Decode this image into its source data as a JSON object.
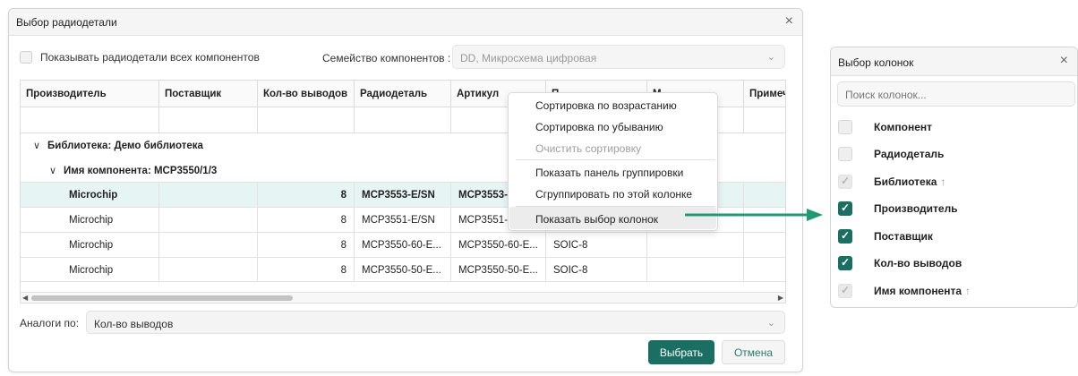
{
  "dialog": {
    "title": "Выбор радиодетали",
    "close": "×",
    "show_all_label": "Показывать радиодетали всех компонентов",
    "family_label": "Семейство компонентов :",
    "family_value": "DD, Микросхема цифровая",
    "chev": "⌄",
    "analog_label": "Аналоги по:",
    "analog_value": "Кол-во выводов",
    "select_btn": "Выбрать",
    "cancel_btn": "Отмена"
  },
  "grid": {
    "headers": [
      "Производитель",
      "Поставщик",
      "Кол-во выводов",
      "Радиодеталь",
      "Артикул",
      "П",
      "М",
      "Примеч"
    ],
    "group1": "Библиотека: Демо библиотека",
    "group2": "Имя компонента: MCP3550/1/3",
    "caret": "∨",
    "rows": [
      {
        "maker": "Microchip",
        "supplier": "",
        "pins": "8",
        "part": "MCP3553-E/SN",
        "article": "MCP3553-",
        "pkg": ""
      },
      {
        "maker": "Microchip",
        "supplier": "",
        "pins": "8",
        "part": "MCP3551-E/SN",
        "article": "MCP3551-E",
        "pkg": ""
      },
      {
        "maker": "Microchip",
        "supplier": "",
        "pins": "8",
        "part": "MCP3550-60-E...",
        "article": "MCP3550-60-E...",
        "pkg": "SOIC-8"
      },
      {
        "maker": "Microchip",
        "supplier": "",
        "pins": "8",
        "part": "MCP3550-50-E...",
        "article": "MCP3550-50-E...",
        "pkg": "SOIC-8"
      }
    ],
    "scroll_left": "◀",
    "scroll_right": "▶"
  },
  "context_menu": {
    "sort_asc": "Сортировка по возрастанию",
    "sort_desc": "Сортировка по убыванию",
    "clear_sort": "Очистить сортировку",
    "show_group_panel": "Показать панель группировки",
    "group_by_column": "Сгруппировать по этой колонке",
    "show_column_chooser": "Показать выбор колонок"
  },
  "column_panel": {
    "title": "Выбор колонок",
    "close": "×",
    "search_placeholder": "Поиск колонок...",
    "up_arrow": "↑",
    "items": [
      {
        "label": "Компонент",
        "state": "off"
      },
      {
        "label": "Радиодеталь",
        "state": "off"
      },
      {
        "label": "Библиотека",
        "state": "dis"
      },
      {
        "label": "Производитель",
        "state": "on"
      },
      {
        "label": "Поставщик",
        "state": "on"
      },
      {
        "label": "Кол-во выводов",
        "state": "on"
      },
      {
        "label": "Имя компонента",
        "state": "dis"
      }
    ],
    "check": "✓"
  },
  "colors": {
    "accent": "#1a6e62",
    "arrow": "#1f9a74",
    "selected_row": "#e6f4f3"
  }
}
